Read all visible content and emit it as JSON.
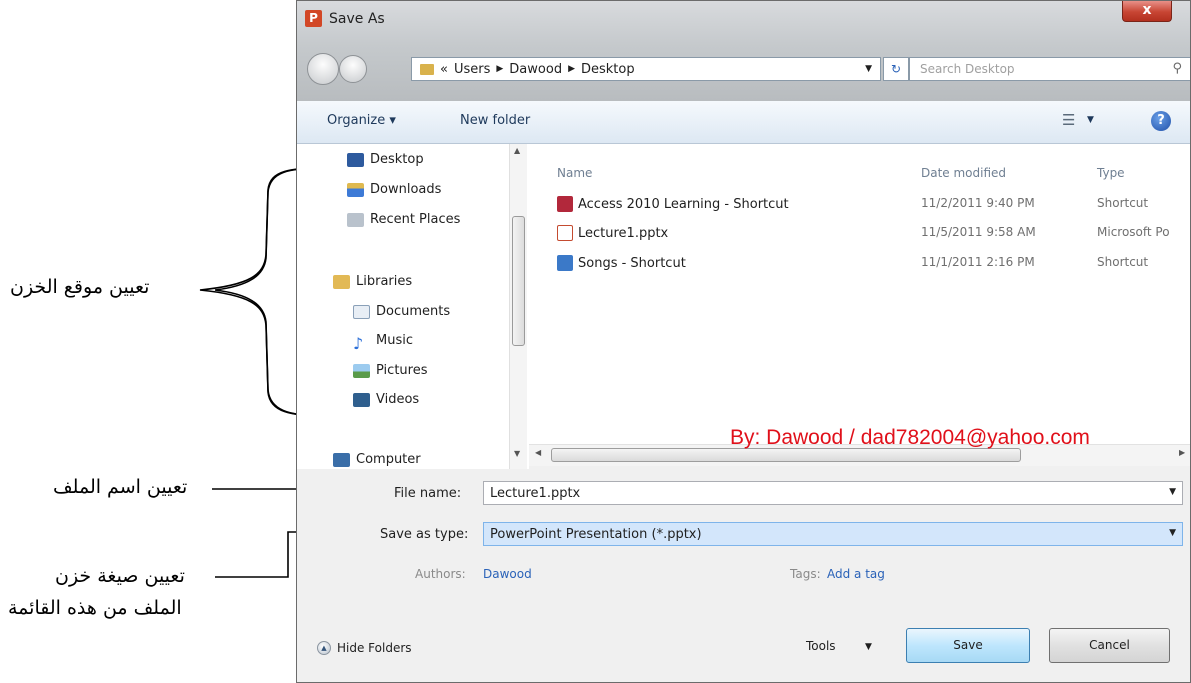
{
  "annotations": {
    "location": "تعيين موقع الخزن",
    "filename": "تعيين اسم الملف",
    "format_line1": "تعيين صيغة خزن",
    "format_line2": "الملف من هذه القائمة"
  },
  "watermark": "By: Dawood / dad782004@yahoo.com",
  "dialog": {
    "title": "Save As",
    "app_icon": "P",
    "close_label": "x",
    "breadcrumb": [
      "«",
      "Users",
      "Dawood",
      "Desktop"
    ],
    "search_placeholder": "Search Desktop",
    "toolbar": {
      "organize": "Organize ▾",
      "new_folder": "New folder"
    },
    "nav": {
      "items": [
        {
          "label": "Desktop",
          "icon": "desktop-icon"
        },
        {
          "label": "Downloads",
          "icon": "downloads-icon"
        },
        {
          "label": "Recent Places",
          "icon": "recent-places-icon"
        },
        {
          "label": "Libraries",
          "icon": "libraries-icon"
        },
        {
          "label": "Documents",
          "icon": "documents-icon"
        },
        {
          "label": "Music",
          "icon": "music-icon"
        },
        {
          "label": "Pictures",
          "icon": "pictures-icon"
        },
        {
          "label": "Videos",
          "icon": "videos-icon"
        },
        {
          "label": "Computer",
          "icon": "computer-icon"
        }
      ]
    },
    "columns": {
      "name": "Name",
      "date": "Date modified",
      "type": "Type"
    },
    "files": [
      {
        "name": "Access 2010 Learning - Shortcut",
        "date": "11/2/2011 9:40 PM",
        "type": "Shortcut",
        "icon": "access-shortcut-icon"
      },
      {
        "name": "Lecture1.pptx",
        "date": "11/5/2011 9:58 AM",
        "type": "Microsoft Po",
        "icon": "pptx-file-icon"
      },
      {
        "name": "Songs - Shortcut",
        "date": "11/1/2011 2:16 PM",
        "type": "Shortcut",
        "icon": "songs-shortcut-icon"
      }
    ],
    "form": {
      "file_name_label": "File name:",
      "file_name_value": "Lecture1.pptx",
      "save_type_label": "Save as type:",
      "save_type_value": "PowerPoint Presentation (*.pptx)",
      "authors_label": "Authors:",
      "authors_value": "Dawood",
      "tags_label": "Tags:",
      "tags_value": "Add a tag"
    },
    "footer": {
      "hide_folders": "Hide Folders",
      "tools": "Tools",
      "save": "Save",
      "cancel": "Cancel"
    }
  }
}
